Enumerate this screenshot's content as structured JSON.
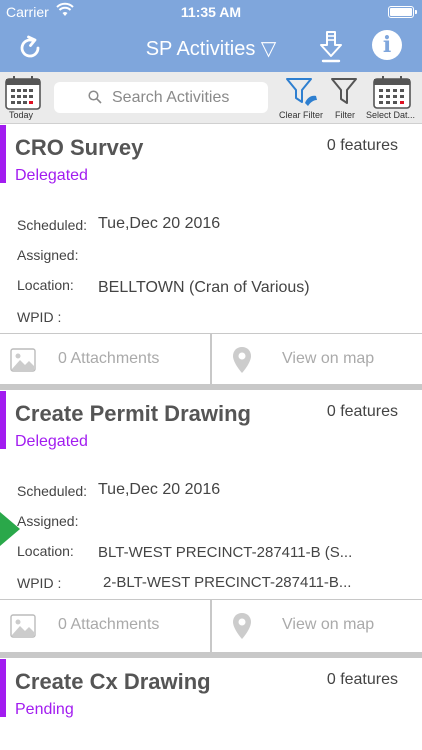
{
  "status_bar": {
    "carrier": "Carrier",
    "time": "11:35 AM"
  },
  "nav": {
    "title": "SP Activities ▽"
  },
  "toolbar": {
    "today_label": "Today",
    "search_placeholder": "Search Activities",
    "clear_filter_label": "Clear Filter",
    "filter_label": "Filter",
    "select_date_label": "Select Dat..."
  },
  "colors": {
    "nav_background": "#7fa6dc",
    "accent_purple": "#a21cf0",
    "play_green": "#2aa84a"
  },
  "cards": [
    {
      "title": "CRO Survey",
      "features": "0 features",
      "status": "Delegated",
      "scheduled_label": "Scheduled:",
      "scheduled": "Tue,Dec 20 2016",
      "assigned_label": "Assigned:",
      "assigned": "",
      "location_label": "Location:",
      "location": "BELLTOWN (Cran of Various)",
      "wpid_label": "WPID :",
      "wpid": "",
      "attachments": "0 Attachments",
      "view_map": "View on map"
    },
    {
      "title": "Create Permit Drawing",
      "features": "0 features",
      "status": "Delegated",
      "scheduled_label": "Scheduled:",
      "scheduled": "Tue,Dec 20 2016",
      "assigned_label": "Assigned:",
      "assigned": "",
      "location_label": "Location:",
      "location": "BLT-WEST PRECINCT-287411-B (S...",
      "wpid_label": "WPID :",
      "wpid": "2-BLT-WEST PRECINCT-287411-B...",
      "attachments": "0 Attachments",
      "view_map": "View on map"
    },
    {
      "title": "Create Cx Drawing",
      "features": "0 features",
      "status": "Pending"
    }
  ]
}
